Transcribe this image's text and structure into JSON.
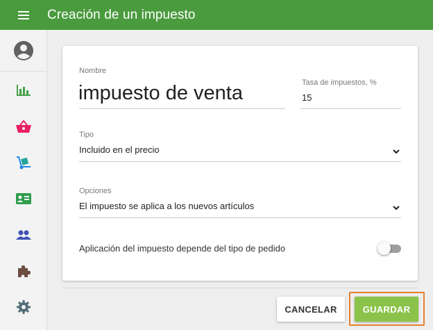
{
  "app": {
    "title": "Creación de un impuesto"
  },
  "sidebar": {
    "items": [
      {
        "icon": "avatar-icon"
      },
      {
        "icon": "bar-chart-icon",
        "color": "#43a047"
      },
      {
        "icon": "basket-icon",
        "color": "#e91e63"
      },
      {
        "icon": "hand-truck-icon",
        "color": "#1e88e5"
      },
      {
        "icon": "id-card-icon",
        "color": "#2e9c4a"
      },
      {
        "icon": "people-icon",
        "color": "#3f51b5"
      },
      {
        "icon": "puzzle-icon",
        "color": "#6d4c41"
      },
      {
        "icon": "gear-icon",
        "color": "#546e7a"
      }
    ]
  },
  "form": {
    "name_label": "Nombre",
    "name_value": "impuesto de venta",
    "rate_label": "Tasa de impuestos, %",
    "rate_value": "15",
    "type_label": "Tipo",
    "type_value": "Incluido en el precio",
    "options_label": "Opciones",
    "options_value": "El impuesto se aplica a los nuevos artículos",
    "toggle_label": "Aplicación del impuesto depende del tipo de pedido",
    "toggle_on": false
  },
  "actions": {
    "cancel_label": "CANCELAR",
    "save_label": "GUARDAR"
  },
  "colors": {
    "topbar": "#4a9a3e",
    "save_button": "#8bc34a",
    "highlight": "#e8802f"
  }
}
